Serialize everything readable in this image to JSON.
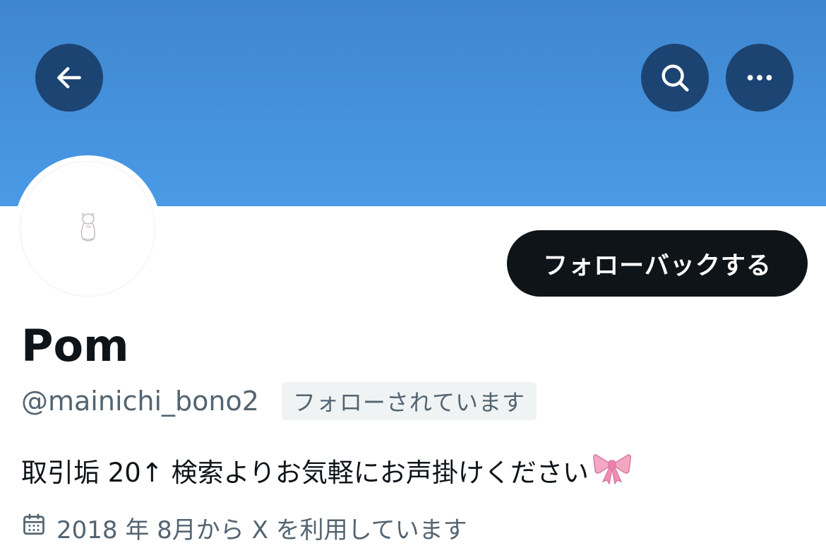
{
  "header": {
    "back_icon": "arrow-left-icon",
    "search_icon": "search-icon",
    "more_icon": "more-horizontal-icon",
    "banner_color": "#4a9ae6"
  },
  "profile": {
    "display_name": "Pom",
    "handle": "@mainichi_bono2",
    "follows_you_badge": "フォローされています",
    "follow_back_label": "フォローバックする",
    "bio_text": "取引垢 20↑ 検索よりお気軽にお声掛けください",
    "bio_emoji": "ribbon-icon",
    "joined_text": "2018 年 8月から X を利用しています",
    "joined_icon": "calendar-icon"
  },
  "colors": {
    "follow_button_bg": "#0f1419",
    "secondary_text": "#536471",
    "badge_bg": "#eff3f4"
  }
}
